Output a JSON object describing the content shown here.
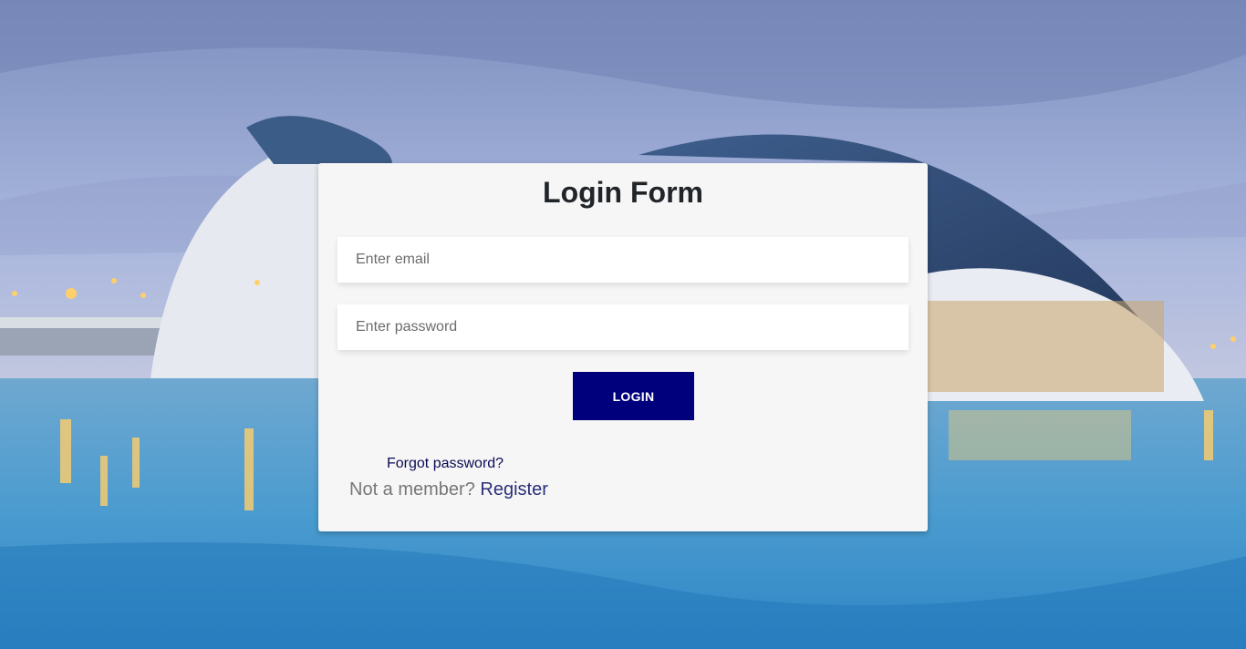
{
  "login_form": {
    "title": "Login Form",
    "email_placeholder": "Enter email",
    "email_value": "",
    "password_placeholder": "Enter password",
    "password_value": "",
    "login_label": "LOGIN",
    "forgot_password_label": "Forgot password?",
    "not_member_text": "Not a member?",
    "register_label": "Register"
  },
  "colors": {
    "card_background": "#f6f6f6",
    "login_button": "#00007d",
    "link": "#2b2f7a"
  }
}
